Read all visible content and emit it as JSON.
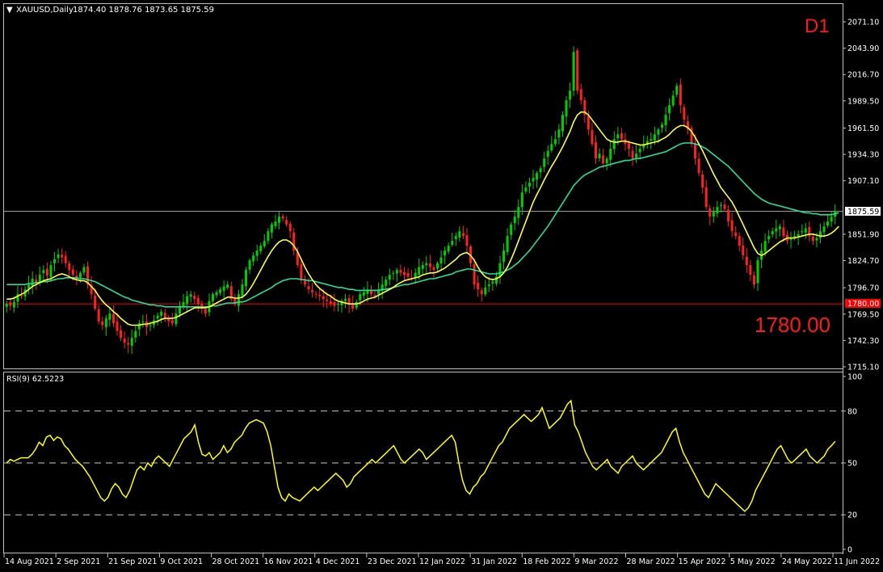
{
  "header": {
    "symbol_label": "XAUUSD,Daily",
    "ohlc": "1874.40 1878.76 1873.65 1875.59",
    "timeframe": "D1"
  },
  "price_panel": {
    "current_price_label": "1875.59",
    "level_tag": "1780.00",
    "level_big": "1780.00",
    "y_ticks": [
      "2071.10",
      "2043.90",
      "2016.70",
      "1989.50",
      "1961.50",
      "1934.30",
      "1907.10",
      "1851.90",
      "1824.70",
      "1796.70",
      "1769.50",
      "1742.30",
      "1715.10"
    ]
  },
  "rsi_panel": {
    "label": "RSI(9) 62.5223",
    "y_ticks": [
      "100",
      "80",
      "50",
      "20",
      "0"
    ]
  },
  "x_axis": {
    "labels": [
      "14 Aug 2021",
      "2 Sep 2021",
      "21 Sep 2021",
      "9 Oct 2021",
      "28 Oct 2021",
      "16 Nov 2021",
      "4 Dec 2021",
      "23 Dec 2021",
      "12 Jan 2022",
      "31 Jan 2022",
      "18 Feb 2022",
      "9 Mar 2022",
      "28 Mar 2022",
      "15 Apr 2022",
      "5 May 2022",
      "24 May 2022",
      "11 Jun 2022"
    ]
  },
  "colors": {
    "bull": "#00d000",
    "bear": "#ff2020",
    "ma_fast": "#ffff40",
    "ma_slow": "#20e0a0",
    "level": "#ff0000",
    "rsi": "#ffff00",
    "grid_border": "#c0c0c0"
  },
  "chart_data": [
    {
      "type": "candlestick",
      "title": "XAUUSD,Daily",
      "ylim": [
        1715.1,
        2071.1
      ],
      "close": [
        1780,
        1778,
        1782,
        1790,
        1788,
        1795,
        1800,
        1806,
        1802,
        1810,
        1815,
        1809,
        1820,
        1826,
        1831,
        1828,
        1822,
        1815,
        1810,
        1806,
        1812,
        1818,
        1800,
        1790,
        1775,
        1762,
        1758,
        1765,
        1770,
        1760,
        1752,
        1745,
        1740,
        1738,
        1745,
        1752,
        1760,
        1762,
        1756,
        1758,
        1763,
        1768,
        1772,
        1765,
        1762,
        1760,
        1770,
        1778,
        1782,
        1788,
        1790,
        1785,
        1780,
        1775,
        1770,
        1783,
        1790,
        1792,
        1795,
        1798,
        1800,
        1785,
        1780,
        1790,
        1800,
        1815,
        1825,
        1830,
        1835,
        1840,
        1845,
        1855,
        1862,
        1865,
        1870,
        1868,
        1862,
        1855,
        1835,
        1820,
        1805,
        1800,
        1795,
        1792,
        1790,
        1788,
        1785,
        1783,
        1780,
        1778,
        1780,
        1783,
        1785,
        1779,
        1775,
        1782,
        1790,
        1792,
        1795,
        1790,
        1788,
        1795,
        1800,
        1805,
        1810,
        1812,
        1815,
        1812,
        1810,
        1808,
        1806,
        1812,
        1818,
        1820,
        1822,
        1818,
        1815,
        1822,
        1828,
        1835,
        1840,
        1845,
        1850,
        1855,
        1850,
        1840,
        1822,
        1800,
        1795,
        1790,
        1797,
        1800,
        1803,
        1808,
        1822,
        1835,
        1850,
        1862,
        1870,
        1880,
        1895,
        1900,
        1905,
        1910,
        1915,
        1920,
        1930,
        1938,
        1945,
        1950,
        1960,
        1975,
        1990,
        2000,
        2040,
        2000,
        1990,
        1975,
        1960,
        1945,
        1930,
        1935,
        1925,
        1930,
        1940,
        1950,
        1955,
        1950,
        1945,
        1940,
        1930,
        1935,
        1940,
        1945,
        1948,
        1950,
        1955,
        1960,
        1965,
        1975,
        1985,
        1995,
        2005,
        1985,
        1970,
        1960,
        1945,
        1930,
        1915,
        1900,
        1880,
        1870,
        1875,
        1880,
        1882,
        1878,
        1865,
        1855,
        1850,
        1840,
        1830,
        1820,
        1810,
        1800,
        1825,
        1835,
        1845,
        1850,
        1855,
        1858,
        1860,
        1850,
        1845,
        1848,
        1850,
        1852,
        1855,
        1858,
        1850,
        1845,
        1848,
        1855,
        1860,
        1865,
        1870,
        1875.59
      ],
      "ma_fast": [
        1785,
        1785,
        1786,
        1788,
        1790,
        1792,
        1795,
        1798,
        1800,
        1802,
        1804,
        1805,
        1806,
        1808,
        1810,
        1811,
        1810,
        1808,
        1806,
        1805,
        1804,
        1804,
        1802,
        1798,
        1794,
        1788,
        1783,
        1779,
        1776,
        1772,
        1769,
        1765,
        1762,
        1759,
        1758,
        1758,
        1758,
        1759,
        1759,
        1760,
        1761,
        1762,
        1764,
        1765,
        1765,
        1765,
        1766,
        1768,
        1770,
        1772,
        1774,
        1776,
        1776,
        1776,
        1776,
        1777,
        1779,
        1781,
        1783,
        1785,
        1787,
        1787,
        1786,
        1786,
        1787,
        1790,
        1795,
        1801,
        1808,
        1815,
        1822,
        1829,
        1835,
        1840,
        1844,
        1846,
        1846,
        1844,
        1840,
        1834,
        1826,
        1818,
        1811,
        1805,
        1800,
        1796,
        1793,
        1790,
        1788,
        1785,
        1783,
        1782,
        1781,
        1780,
        1780,
        1780,
        1781,
        1783,
        1785,
        1786,
        1787,
        1789,
        1791,
        1793,
        1795,
        1797,
        1800,
        1802,
        1804,
        1805,
        1806,
        1807,
        1808,
        1810,
        1811,
        1812,
        1812,
        1813,
        1815,
        1817,
        1820,
        1823,
        1826,
        1830,
        1832,
        1833,
        1830,
        1825,
        1818,
        1812,
        1808,
        1806,
        1805,
        1806,
        1808,
        1812,
        1818,
        1826,
        1835,
        1845,
        1855,
        1865,
        1875,
        1885,
        1893,
        1900,
        1908,
        1915,
        1922,
        1928,
        1935,
        1942,
        1950,
        1958,
        1968,
        1975,
        1978,
        1978,
        1975,
        1970,
        1965,
        1960,
        1955,
        1950,
        1948,
        1947,
        1947,
        1948,
        1948,
        1947,
        1946,
        1945,
        1944,
        1944,
        1945,
        1946,
        1947,
        1948,
        1950,
        1952,
        1955,
        1959,
        1962,
        1964,
        1964,
        1962,
        1958,
        1952,
        1945,
        1938,
        1930,
        1922,
        1914,
        1907,
        1900,
        1895,
        1890,
        1885,
        1878,
        1870,
        1862,
        1854,
        1846,
        1838,
        1832,
        1830,
        1832,
        1835,
        1838,
        1841,
        1844,
        1846,
        1848,
        1848,
        1848,
        1849,
        1850,
        1851,
        1852,
        1852,
        1851,
        1850,
        1850,
        1851,
        1853,
        1856,
        1860
      ],
      "ma_slow": [
        1800,
        1800,
        1800,
        1800,
        1800,
        1800,
        1801,
        1801,
        1802,
        1802,
        1803,
        1803,
        1804,
        1805,
        1806,
        1806,
        1807,
        1807,
        1807,
        1807,
        1806,
        1806,
        1805,
        1804,
        1803,
        1801,
        1799,
        1797,
        1795,
        1793,
        1791,
        1789,
        1787,
        1786,
        1784,
        1783,
        1782,
        1781,
        1780,
        1779,
        1779,
        1778,
        1778,
        1777,
        1777,
        1777,
        1777,
        1777,
        1777,
        1777,
        1777,
        1777,
        1777,
        1777,
        1777,
        1777,
        1778,
        1778,
        1779,
        1780,
        1781,
        1781,
        1781,
        1782,
        1782,
        1783,
        1785,
        1787,
        1789,
        1791,
        1793,
        1795,
        1797,
        1800,
        1802,
        1804,
        1805,
        1806,
        1806,
        1806,
        1805,
        1805,
        1804,
        1804,
        1803,
        1802,
        1801,
        1800,
        1799,
        1798,
        1797,
        1797,
        1796,
        1795,
        1795,
        1794,
        1794,
        1794,
        1794,
        1794,
        1794,
        1794,
        1795,
        1795,
        1796,
        1797,
        1798,
        1799,
        1800,
        1800,
        1801,
        1802,
        1803,
        1804,
        1805,
        1806,
        1806,
        1807,
        1808,
        1809,
        1810,
        1811,
        1813,
        1814,
        1815,
        1816,
        1816,
        1815,
        1814,
        1813,
        1812,
        1811,
        1811,
        1811,
        1812,
        1813,
        1815,
        1817,
        1820,
        1823,
        1827,
        1831,
        1835,
        1840,
        1845,
        1850,
        1855,
        1860,
        1866,
        1872,
        1878,
        1884,
        1890,
        1896,
        1902,
        1906,
        1910,
        1913,
        1915,
        1917,
        1919,
        1921,
        1922,
        1923,
        1924,
        1925,
        1926,
        1927,
        1928,
        1928,
        1929,
        1930,
        1930,
        1931,
        1932,
        1933,
        1934,
        1935,
        1936,
        1937,
        1939,
        1941,
        1943,
        1945,
        1946,
        1946,
        1946,
        1945,
        1944,
        1942,
        1940,
        1937,
        1934,
        1931,
        1928,
        1925,
        1922,
        1918,
        1914,
        1910,
        1906,
        1902,
        1898,
        1894,
        1891,
        1888,
        1886,
        1884,
        1883,
        1882,
        1881,
        1880,
        1879,
        1878,
        1877,
        1876,
        1875,
        1874,
        1874,
        1873,
        1873,
        1872,
        1872,
        1872,
        1872,
        1873,
        1874
      ]
    },
    {
      "type": "line",
      "title": "RSI(9) 62.5223",
      "ylim": [
        0,
        100
      ],
      "levels": [
        80,
        50,
        20
      ],
      "values": [
        50,
        52,
        51,
        52,
        53,
        53,
        53,
        55,
        58,
        62,
        60,
        65,
        66,
        63,
        65,
        64,
        60,
        58,
        55,
        52,
        50,
        48,
        45,
        42,
        38,
        34,
        30,
        28,
        30,
        35,
        38,
        36,
        32,
        30,
        34,
        40,
        46,
        48,
        46,
        50,
        48,
        52,
        54,
        52,
        50,
        48,
        52,
        56,
        60,
        64,
        66,
        68,
        72,
        62,
        55,
        54,
        56,
        52,
        54,
        56,
        60,
        56,
        58,
        62,
        64,
        66,
        70,
        73,
        74,
        75,
        74,
        73,
        68,
        60,
        48,
        36,
        30,
        28,
        32,
        30,
        29,
        28,
        30,
        32,
        34,
        36,
        34,
        36,
        38,
        40,
        42,
        44,
        42,
        40,
        36,
        38,
        42,
        44,
        46,
        48,
        50,
        52,
        50,
        52,
        54,
        56,
        58,
        60,
        56,
        52,
        50,
        52,
        54,
        56,
        58,
        56,
        52,
        54,
        56,
        58,
        60,
        62,
        64,
        66,
        62,
        50,
        40,
        34,
        32,
        36,
        38,
        42,
        44,
        48,
        52,
        56,
        60,
        62,
        66,
        70,
        72,
        74,
        76,
        78,
        76,
        74,
        76,
        78,
        82,
        76,
        70,
        72,
        74,
        76,
        80,
        84,
        86,
        72,
        68,
        62,
        56,
        52,
        48,
        46,
        48,
        50,
        52,
        48,
        46,
        44,
        48,
        50,
        52,
        54,
        50,
        48,
        46,
        48,
        50,
        52,
        54,
        56,
        60,
        64,
        68,
        70,
        62,
        56,
        52,
        48,
        44,
        40,
        36,
        32,
        30,
        34,
        38,
        36,
        34,
        32,
        30,
        28,
        26,
        24,
        22,
        24,
        28,
        34,
        38,
        42,
        46,
        50,
        54,
        58,
        60,
        56,
        52,
        50,
        52,
        54,
        56,
        58,
        54,
        52,
        50,
        52,
        54,
        58,
        60,
        62.52
      ]
    }
  ]
}
